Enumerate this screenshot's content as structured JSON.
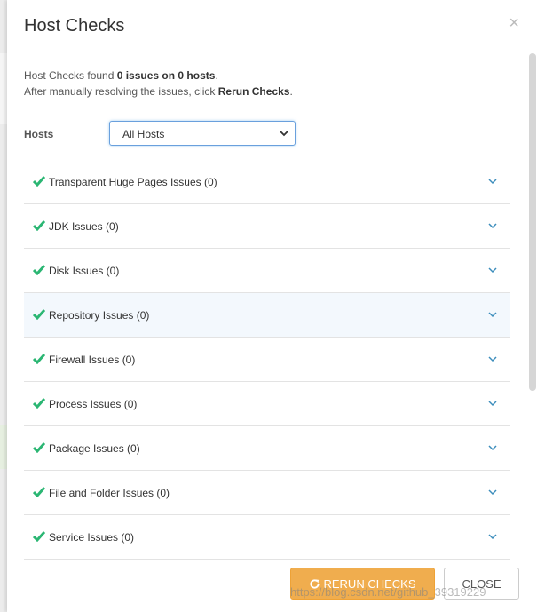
{
  "dialog": {
    "title": "Host Checks",
    "close_symbol": "×"
  },
  "summary": {
    "line1_prefix": "Host Checks found ",
    "line1_bold": "0 issues on 0 hosts",
    "line1_suffix": ".",
    "line2_prefix": "After manually resolving the issues, click ",
    "line2_bold": "Rerun Checks",
    "line2_suffix": "."
  },
  "hosts": {
    "label": "Hosts",
    "selected": "All Hosts"
  },
  "issues": [
    {
      "label": "Transparent Huge Pages Issues (0)"
    },
    {
      "label": "JDK Issues (0)"
    },
    {
      "label": "Disk Issues (0)"
    },
    {
      "label": "Repository Issues (0)"
    },
    {
      "label": "Firewall Issues (0)"
    },
    {
      "label": "Process Issues (0)"
    },
    {
      "label": "Package Issues (0)"
    },
    {
      "label": "File and Folder Issues (0)"
    },
    {
      "label": "Service Issues (0)"
    }
  ],
  "buttons": {
    "rerun_label": "RERUN CHECKS",
    "close_label": "CLOSE"
  },
  "watermark": "https://blog.csdn.net/github_39319229",
  "colors": {
    "check_green": "#2bb673",
    "chevron_blue": "#3c8dbc",
    "rerun_orange": "#f0ad4e",
    "highlight_row": "#f3f8fd"
  },
  "icons": {
    "status": "check-icon",
    "expand": "chevron-down-icon",
    "rerun": "refresh-icon",
    "close": "close-icon"
  }
}
